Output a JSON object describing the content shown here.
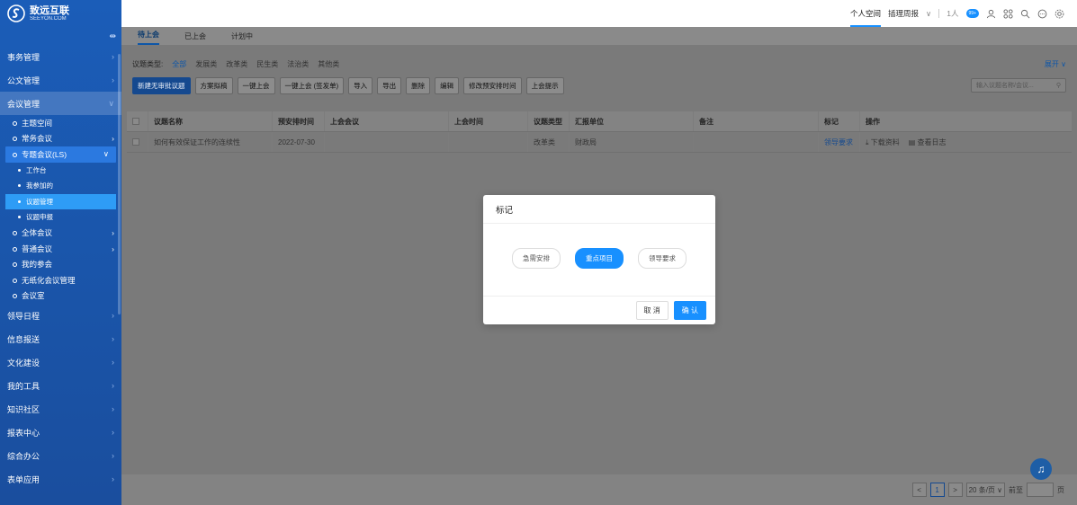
{
  "brand": {
    "name": "致远互联",
    "sub": "SEEYON.COM",
    "color": "#1b5db8"
  },
  "sidebar": {
    "collapse_icon": "collapse-icon",
    "top": [
      {
        "label": "事务管理"
      },
      {
        "label": "公文管理"
      },
      {
        "label": "会议管理"
      }
    ],
    "meeting_subs": [
      {
        "label": "主题空间"
      },
      {
        "label": "常务会议"
      },
      {
        "label": "专题会议(LS)"
      }
    ],
    "topic_leaves": [
      {
        "label": "工作台"
      },
      {
        "label": "我参加的"
      },
      {
        "label": "议题管理"
      },
      {
        "label": "议题申报"
      }
    ],
    "meeting_subs2": [
      {
        "label": "全体会议"
      },
      {
        "label": "普通会议"
      },
      {
        "label": "我的参会"
      },
      {
        "label": "无纸化会议管理"
      },
      {
        "label": "会议室"
      }
    ],
    "bottom": [
      {
        "label": "领导日程"
      },
      {
        "label": "信息报送"
      },
      {
        "label": "文化建设"
      },
      {
        "label": "我的工具"
      },
      {
        "label": "知识社区"
      },
      {
        "label": "报表中心"
      },
      {
        "label": "综合办公"
      },
      {
        "label": "表单应用"
      }
    ]
  },
  "topbar": {
    "personal_space": "个人空间",
    "agency": "插理周报",
    "count": "1人",
    "badge": "99+",
    "icons": [
      "user-icon",
      "apps-icon",
      "search-icon",
      "message-icon",
      "settings-icon"
    ]
  },
  "tabs": [
    "待上会",
    "已上会",
    "计划中"
  ],
  "filters": {
    "label": "议题类型:",
    "items": [
      "全部",
      "发展类",
      "改革类",
      "民生类",
      "法治类",
      "其他类"
    ],
    "expand": "展开 ∨"
  },
  "toolbar": {
    "buttons": [
      "新建无审批议题",
      "方案拟稿",
      "一键上会",
      "一键上会 (签发单)",
      "导入",
      "导出",
      "删除",
      "编辑",
      "修改预安排时间",
      "上会提示"
    ],
    "search_placeholder": "输入议题名称/会议...",
    "search_icon": "search-icon"
  },
  "table": {
    "headers": [
      "议题名称",
      "预安排时间",
      "上会会议",
      "上会时间",
      "议题类型",
      "汇报单位",
      "备注",
      "标记",
      "操作"
    ],
    "rows": [
      {
        "name": "如何有效保证工作的连续性",
        "time": "2022-07-30",
        "meeting": "",
        "meeting_time": "",
        "type": "改革类",
        "unit": "财政局",
        "remark": "",
        "mark": "领导要求",
        "download": "下载资料",
        "log": "查看日志"
      }
    ]
  },
  "pager": {
    "prev": "<",
    "page": "1",
    "next": ">",
    "size": "20 条/页 ∨",
    "goto": "前至",
    "unit": "页"
  },
  "modal": {
    "title": "标记",
    "options": [
      "急需安排",
      "重点项目",
      "领导要求"
    ],
    "selected_index": 1,
    "cancel": "取 消",
    "ok": "确 认"
  }
}
